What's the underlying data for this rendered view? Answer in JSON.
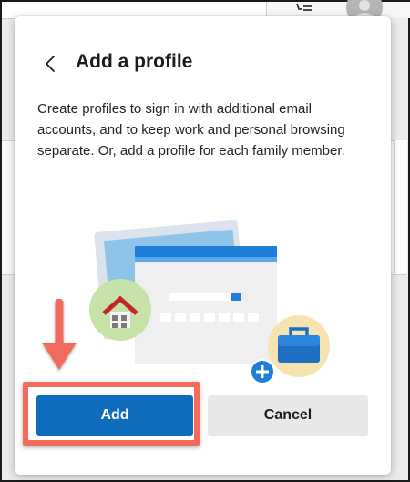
{
  "dialog": {
    "title": "Add a profile",
    "description": "Create profiles to sign in with additional email accounts, and to keep work and personal browsing separate. Or, add a profile for each family member.",
    "add_label": "Add",
    "cancel_label": "Cancel"
  },
  "icons": {
    "back": "chevron-left-icon",
    "illustration": "profiles-illustration",
    "home": "home-icon",
    "briefcase": "briefcase-icon",
    "plus": "plus-icon",
    "annotation": "arrow-down-annotation"
  },
  "colors": {
    "primary_button": "#0f6cbd",
    "secondary_button": "#e8e8e8",
    "annotation": "#f26b5b"
  }
}
